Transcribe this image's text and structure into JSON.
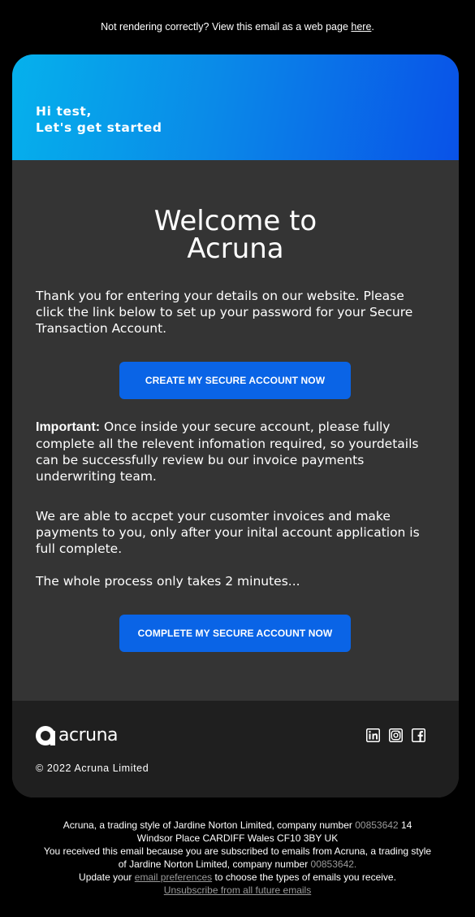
{
  "preheader": {
    "text": "Not rendering correctly? View this email as a web page ",
    "link": "here",
    "suffix": "."
  },
  "header": {
    "line1": "Hi test,",
    "line2": "Let's get started"
  },
  "main": {
    "title_line1": "Welcome to",
    "title_line2": "Acruna",
    "intro": "Thank you for entering your details on our website. Please click the link below to set up your password for your Secure Transaction Account.",
    "button1": "CREATE MY SECURE ACCOUNT NOW",
    "important_label": "Important:",
    "important_text": " Once inside your secure account, please fully complete all the relevent infomation required, so yourdetails can be successfully review bu our invoice payments underwriting team.",
    "para2": "We are able to accpet your cusomter invoices and make payments to you, only after your inital account application is full complete.",
    "para3": "The whole process only takes 2 minutes...",
    "button2": "COMPLETE MY SECURE ACCOUNT NOW"
  },
  "footer": {
    "logo_text": "acruna",
    "copyright": "© 2022 Acruna Limited",
    "social": [
      "linkedin-icon",
      "instagram-icon",
      "facebook-icon"
    ]
  },
  "legal": {
    "line1a": "Acruna, a trading style of Jardine Norton Limited, company number ",
    "company_number": "00853642",
    "line1b": "  14",
    "line2": "Windsor Place  CARDIFF  Wales  CF10 3BY  UK",
    "line3": "You received this email because you are subscribed to emails from Acruna, a trading style",
    "line4a": "of Jardine Norton Limited, company number ",
    "company_number2": "00853642.",
    "line5a": "Update your ",
    "pref_link": "email preferences",
    "line5b": " to choose the types of emails you receive.",
    "unsubscribe": "Unsubscribe from all future emails"
  },
  "colors": {
    "accent": "#0a64e6",
    "gradient_start": "#05b1ec",
    "gradient_end": "#0952e8",
    "card_bg": "#343434",
    "footer_bg": "#1f1f1f"
  }
}
